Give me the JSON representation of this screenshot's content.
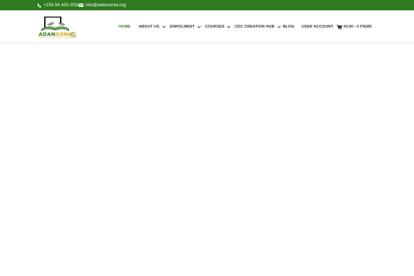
{
  "topbar": {
    "phone": "+233 54 433 2030",
    "email": "info@adansonia.org",
    "phone_icon": "phone-icon",
    "email_icon": "envelope-icon",
    "background_color": "#2f7b1f"
  },
  "logo": {
    "text_part1": "ADAN",
    "text_part2": "SONIA",
    "icon": "open-book-icon",
    "brand_green": "#2f7b1f",
    "brand_gold": "#d4a516"
  },
  "nav": {
    "home": "HOME",
    "about": "ABOUT US",
    "enrolment": "ENROLMENT",
    "courses": "COURSES",
    "cdc": "CDC CREATION HUB",
    "blog": "BLOG",
    "account": "USER ACCOUNT",
    "active_color": "#2f7b1f",
    "dropdown_icon": "chevron-down-icon"
  },
  "cart": {
    "label": "¢0.00 - 0 ITEMS",
    "icon": "shopping-cart-icon"
  }
}
